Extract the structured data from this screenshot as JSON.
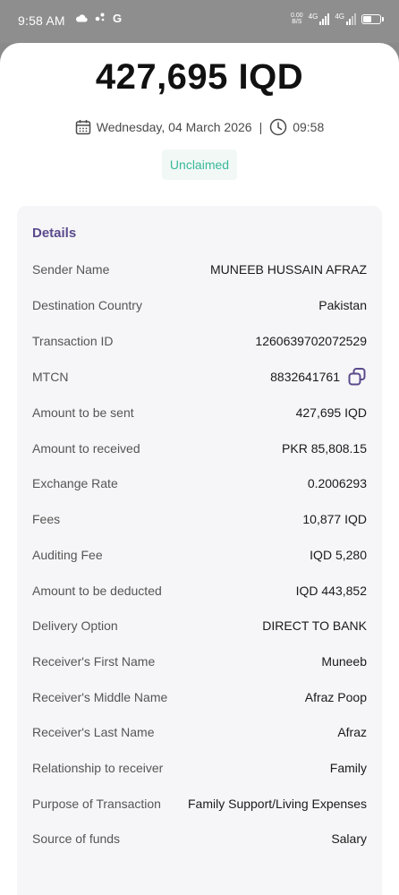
{
  "status_bar": {
    "time": "9:58 AM",
    "left_icons": [
      "cloud-icon",
      "settings-dots-icon",
      "google-icon"
    ],
    "google_letter": "G",
    "net_speed_value": "0.00",
    "net_speed_unit": "B/S",
    "network_label_1": "4G",
    "network_label_2": "4G",
    "battery_level": 0.55
  },
  "header": {
    "amount": "427,695 IQD",
    "date": "Wednesday, 04 March 2026",
    "separator": "|",
    "time": "09:58",
    "status": "Unclaimed"
  },
  "details": {
    "heading": "Details",
    "rows": [
      {
        "label": "Sender Name",
        "value": "MUNEEB HUSSAIN AFRAZ"
      },
      {
        "label": "Destination Country",
        "value": "Pakistan"
      },
      {
        "label": "Transaction ID",
        "value": "1260639702072529"
      },
      {
        "label": "MTCN",
        "value": "8832641761",
        "icon": "copy-icon"
      },
      {
        "label": "Amount to be sent",
        "value": "427,695 IQD"
      },
      {
        "label": "Amount to received",
        "value": "PKR 85,808.15"
      },
      {
        "label": "Exchange Rate",
        "value": "0.2006293"
      },
      {
        "label": "Fees",
        "value": "10,877 IQD"
      },
      {
        "label": "Auditing Fee",
        "value": "IQD 5,280"
      },
      {
        "label": "Amount to be deducted",
        "value": "IQD 443,852"
      },
      {
        "label": "Delivery Option",
        "value": "DIRECT TO BANK"
      },
      {
        "label": "Receiver's First Name",
        "value": "Muneeb"
      },
      {
        "label": "Receiver's Middle Name",
        "value": "Afraz Poop"
      },
      {
        "label": "Receiver's Last Name",
        "value": "Afraz"
      },
      {
        "label": "Relationship to receiver",
        "value": "Family"
      },
      {
        "label": "Purpose of Transaction",
        "value": "Family Support/Living Expenses"
      },
      {
        "label": "Source of funds",
        "value": "Salary"
      }
    ]
  },
  "colors": {
    "accent_purple": "#5b4a8c",
    "status_green": "#3ab99a",
    "copy_icon": "#5b4a8c"
  }
}
